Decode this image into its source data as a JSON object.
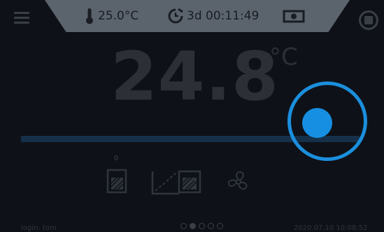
{
  "topbar": {
    "set_temperature": "25.0°C",
    "timer": "3d 00:11:49"
  },
  "display": {
    "current_temperature": "24.8",
    "unit": "°C",
    "small_value": "0"
  },
  "footer": {
    "login": "login: tom",
    "datetime": "2020.07.10 10:08:52"
  },
  "pagination": {
    "total": 4,
    "active": 1
  },
  "colors": {
    "background": "#0d1117",
    "topbar": "#5b636d",
    "touch_indicator": "#1b8fdd"
  }
}
